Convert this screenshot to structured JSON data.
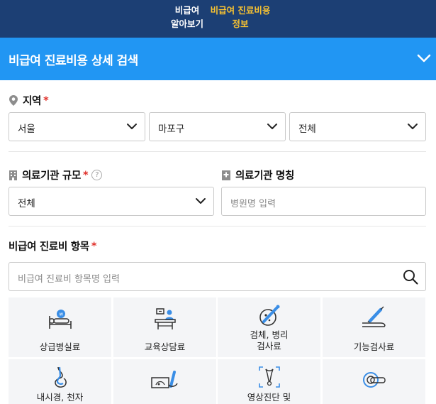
{
  "top_nav": {
    "tabs": [
      {
        "line1": "비급여",
        "line2": "알아보기"
      },
      {
        "line1": "비급여 진료비용",
        "line2": "정보"
      }
    ]
  },
  "section": {
    "title": "비급여 진료비용 상세 검색"
  },
  "region": {
    "label": "지역",
    "required_mark": "*",
    "selects": [
      "서울",
      "마포구",
      "전체"
    ]
  },
  "facility_size": {
    "label": "의료기관 규모",
    "required_mark": "*",
    "help": "?",
    "value": "전체"
  },
  "facility_name": {
    "label": "의료기관 명칭",
    "placeholder": "병원명 입력"
  },
  "items": {
    "label": "비급여 진료비 항목",
    "required_mark": "*",
    "placeholder": "비급여 진료비 항목명 입력"
  },
  "categories": [
    {
      "line1": "상급병실료",
      "line2": "",
      "icon": "hospital-bed-icon"
    },
    {
      "line1": "교육상담료",
      "line2": "",
      "icon": "consultation-desk-icon"
    },
    {
      "line1": "검체, 병리",
      "line2": "검사료",
      "icon": "specimen-pathology-icon"
    },
    {
      "line1": "기능검사료",
      "line2": "",
      "icon": "function-test-icon"
    },
    {
      "line1": "내시경, 천자",
      "line2": "",
      "icon": "endoscopy-icon"
    },
    {
      "line1": "",
      "line2": "",
      "icon": "ultrasound-icon"
    },
    {
      "line1": "영상진단 및",
      "line2": "",
      "icon": "imaging-diagnosis-icon"
    },
    {
      "line1": "",
      "line2": "",
      "icon": "mri-scanner-icon"
    }
  ],
  "colors": {
    "nav_bg": "#1c3f74",
    "accent_yellow": "#f7c232",
    "section_bar": "#2196f3",
    "required": "#e0302a"
  }
}
